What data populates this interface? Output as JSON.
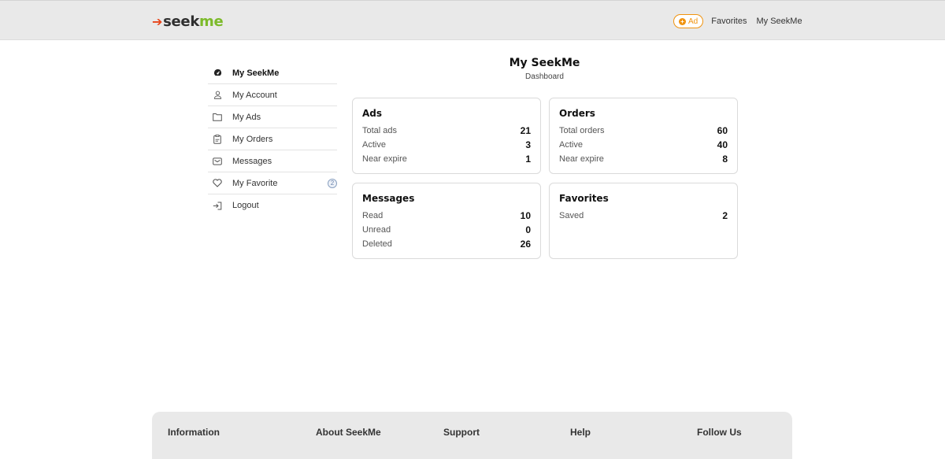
{
  "header": {
    "logo": {
      "arrow": "➔",
      "seek": "seek",
      "me": "me"
    },
    "ad_button": {
      "plus": "+",
      "label": "Ad"
    },
    "links": [
      "Favorites",
      "My SeekMe"
    ]
  },
  "sidebar": {
    "items": [
      {
        "label": "My SeekMe",
        "icon": "dashboard-icon"
      },
      {
        "label": "My Account",
        "icon": "user-icon"
      },
      {
        "label": "My Ads",
        "icon": "folder-icon"
      },
      {
        "label": "My Orders",
        "icon": "clipboard-icon"
      },
      {
        "label": "Messages",
        "icon": "envelope-icon"
      },
      {
        "label": "My Favorite",
        "icon": "heart-icon",
        "badge": "2"
      },
      {
        "label": "Logout",
        "icon": "logout-icon"
      }
    ]
  },
  "page": {
    "title": "My SeekMe",
    "subtitle": "Dashboard"
  },
  "cards": {
    "ads": {
      "title": "Ads",
      "rows": [
        {
          "label": "Total ads",
          "value": "21"
        },
        {
          "label": "Active",
          "value": "3"
        },
        {
          "label": "Near expire",
          "value": "1"
        }
      ]
    },
    "orders": {
      "title": "Orders",
      "rows": [
        {
          "label": "Total orders",
          "value": "60"
        },
        {
          "label": "Active",
          "value": "40"
        },
        {
          "label": "Near expire",
          "value": "8"
        }
      ]
    },
    "messages": {
      "title": "Messages",
      "rows": [
        {
          "label": "Read",
          "value": "10"
        },
        {
          "label": "Unread",
          "value": "0"
        },
        {
          "label": "Deleted",
          "value": "26"
        }
      ]
    },
    "favorites": {
      "title": "Favorites",
      "rows": [
        {
          "label": "Saved",
          "value": "2"
        }
      ]
    }
  },
  "footer": {
    "columns": [
      "Information",
      "About SeekMe",
      "Support",
      "Help",
      "Follow Us"
    ]
  },
  "colors": {
    "accent_orange": "#f0930f",
    "logo_arrow": "#e8461b",
    "logo_green": "#7cba2a",
    "header_bg": "#e9e9e9"
  }
}
